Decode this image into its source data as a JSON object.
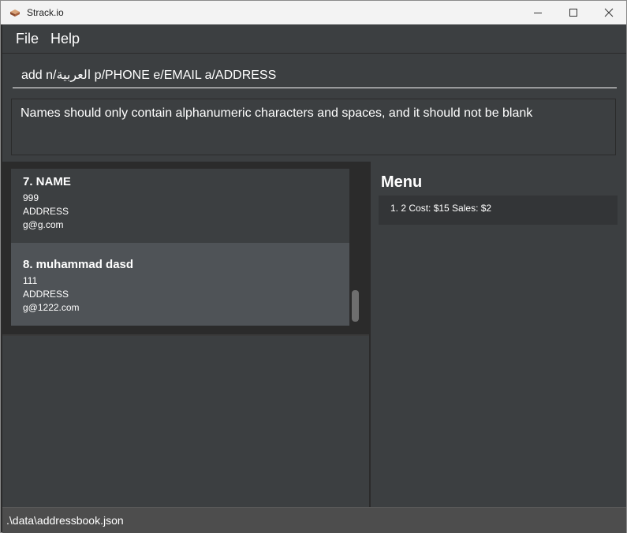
{
  "window": {
    "title": "Strack.io"
  },
  "menubar": {
    "file": "File",
    "help": "Help"
  },
  "command": {
    "value": "add n/العربية p/PHONE e/EMAIL a/ADDRESS"
  },
  "result": {
    "message": "Names should only contain alphanumeric characters and spaces, and it should not be blank"
  },
  "persons": [
    {
      "index_name": "7.  NAME",
      "phone": "999",
      "address": "ADDRESS",
      "email": "g@g.com"
    },
    {
      "index_name": "8.  muhammad dasd",
      "phone": "111",
      "address": "ADDRESS",
      "email": "g@1222.com"
    }
  ],
  "menu_panel": {
    "title": "Menu",
    "items": [
      "1. 2  Cost: $15  Sales: $2"
    ]
  },
  "status": {
    "path": ".\\data\\addressbook.json"
  },
  "colors": {
    "selected_card": "#4f5357",
    "card": "#3c3f41",
    "background": "#2b2b2b"
  }
}
